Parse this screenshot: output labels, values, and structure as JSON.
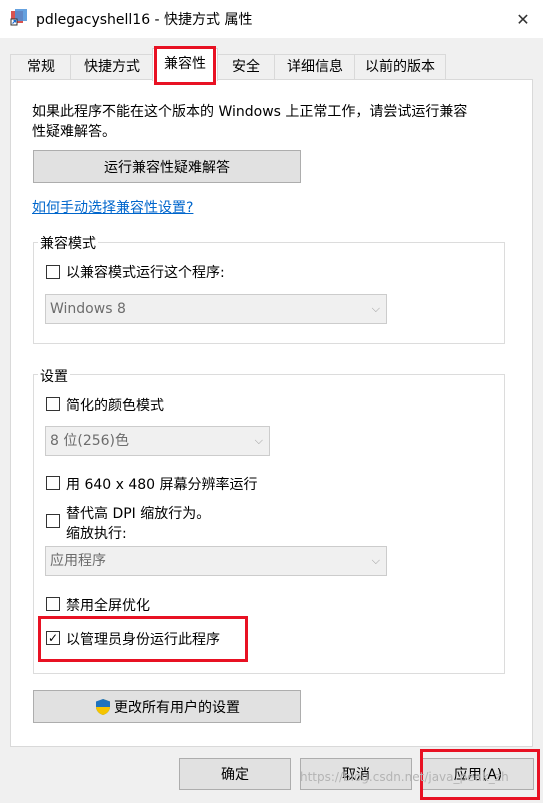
{
  "window": {
    "title": "pdlegacyshell16 - 快捷方式 属性",
    "close_glyph": "✕"
  },
  "tabs": [
    {
      "label": "常规"
    },
    {
      "label": "快捷方式"
    },
    {
      "label": "兼容性"
    },
    {
      "label": "安全"
    },
    {
      "label": "详细信息"
    },
    {
      "label": "以前的版本"
    }
  ],
  "intro_text_line1": "如果此程序不能在这个版本的 Windows 上正常工作，请尝试运行兼容",
  "intro_text_line2": "性疑难解答。",
  "troubleshooter_button": "运行兼容性疑难解答",
  "manual_link": "如何手动选择兼容性设置?",
  "compat_mode": {
    "title": "兼容模式",
    "checkbox_label": "以兼容模式运行这个程序:",
    "checked": false,
    "select_value": "Windows 8"
  },
  "settings": {
    "title": "设置",
    "reduced_color": {
      "label": "简化的颜色模式",
      "checked": false
    },
    "color_select_value": "8 位(256)色",
    "run_640": {
      "label": "用 640 x 480 屏幕分辨率运行",
      "checked": false
    },
    "dpi_override": {
      "label_line1": "替代高 DPI 缩放行为。",
      "label_line2": "缩放执行:",
      "checked": false
    },
    "dpi_select_value": "应用程序",
    "disable_fullscreen": {
      "label": "禁用全屏优化",
      "checked": false
    },
    "run_as_admin": {
      "label": "以管理员身份运行此程序",
      "checked": true
    }
  },
  "change_all_users_button": "更改所有用户的设置",
  "bottom": {
    "ok": "确定",
    "cancel": "取消",
    "apply": "应用(A)"
  },
  "watermark": "https://blog.csdn.net/java_peak_zh",
  "colors": {
    "highlight_red": "#e81123",
    "link_blue": "#0066cc",
    "uac_shield_blue": "#1e73be",
    "uac_shield_yellow": "#f5c400"
  },
  "icons": [
    "shortcut-app-icon",
    "close-icon",
    "checkmark-icon",
    "dropdown-arrow-icon",
    "uac-shield-icon"
  ]
}
